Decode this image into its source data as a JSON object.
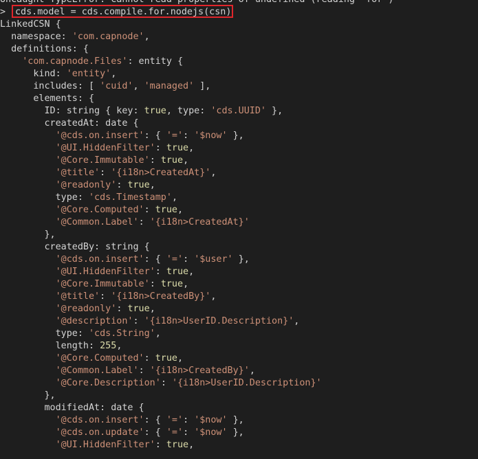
{
  "console": {
    "error_line": "Uncaught TypeError: Cannot read properties of undefined (reading 'for')",
    "prompt_symbol": ">",
    "command": "cds.model = cds.compile.for.nodejs(csn)",
    "highlight_color": "#e0262b",
    "output_lines": [
      [
        {
          "t": "LinkedCSN {",
          "c": "t-cls"
        }
      ],
      [
        {
          "t": "  namespace: ",
          "c": "t-plain"
        },
        {
          "t": "'com.capnode'",
          "c": "t-str"
        },
        {
          "t": ",",
          "c": "t-plain"
        }
      ],
      [
        {
          "t": "  definitions: {",
          "c": "t-plain"
        }
      ],
      [
        {
          "t": "    ",
          "c": "t-plain"
        },
        {
          "t": "'com.capnode.Files'",
          "c": "t-str"
        },
        {
          "t": ": entity {",
          "c": "t-plain"
        }
      ],
      [
        {
          "t": "      kind: ",
          "c": "t-plain"
        },
        {
          "t": "'entity'",
          "c": "t-str"
        },
        {
          "t": ",",
          "c": "t-plain"
        }
      ],
      [
        {
          "t": "      includes: [ ",
          "c": "t-plain"
        },
        {
          "t": "'cuid'",
          "c": "t-str"
        },
        {
          "t": ", ",
          "c": "t-plain"
        },
        {
          "t": "'managed'",
          "c": "t-str"
        },
        {
          "t": " ],",
          "c": "t-plain"
        }
      ],
      [
        {
          "t": "      elements: {",
          "c": "t-plain"
        }
      ],
      [
        {
          "t": "        ID: string { key: ",
          "c": "t-plain"
        },
        {
          "t": "true",
          "c": "t-kw"
        },
        {
          "t": ", type: ",
          "c": "t-plain"
        },
        {
          "t": "'cds.UUID'",
          "c": "t-str"
        },
        {
          "t": " },",
          "c": "t-plain"
        }
      ],
      [
        {
          "t": "        createdAt: date {",
          "c": "t-plain"
        }
      ],
      [
        {
          "t": "          ",
          "c": "t-plain"
        },
        {
          "t": "'@cds.on.insert'",
          "c": "t-str"
        },
        {
          "t": ": { ",
          "c": "t-plain"
        },
        {
          "t": "'='",
          "c": "t-str"
        },
        {
          "t": ": ",
          "c": "t-plain"
        },
        {
          "t": "'$now'",
          "c": "t-str"
        },
        {
          "t": " },",
          "c": "t-plain"
        }
      ],
      [
        {
          "t": "          ",
          "c": "t-plain"
        },
        {
          "t": "'@UI.HiddenFilter'",
          "c": "t-str"
        },
        {
          "t": ": ",
          "c": "t-plain"
        },
        {
          "t": "true",
          "c": "t-kw"
        },
        {
          "t": ",",
          "c": "t-plain"
        }
      ],
      [
        {
          "t": "          ",
          "c": "t-plain"
        },
        {
          "t": "'@Core.Immutable'",
          "c": "t-str"
        },
        {
          "t": ": ",
          "c": "t-plain"
        },
        {
          "t": "true",
          "c": "t-kw"
        },
        {
          "t": ",",
          "c": "t-plain"
        }
      ],
      [
        {
          "t": "          ",
          "c": "t-plain"
        },
        {
          "t": "'@title'",
          "c": "t-str"
        },
        {
          "t": ": ",
          "c": "t-plain"
        },
        {
          "t": "'{i18n>CreatedAt}'",
          "c": "t-str"
        },
        {
          "t": ",",
          "c": "t-plain"
        }
      ],
      [
        {
          "t": "          ",
          "c": "t-plain"
        },
        {
          "t": "'@readonly'",
          "c": "t-str"
        },
        {
          "t": ": ",
          "c": "t-plain"
        },
        {
          "t": "true",
          "c": "t-kw"
        },
        {
          "t": ",",
          "c": "t-plain"
        }
      ],
      [
        {
          "t": "          type: ",
          "c": "t-plain"
        },
        {
          "t": "'cds.Timestamp'",
          "c": "t-str"
        },
        {
          "t": ",",
          "c": "t-plain"
        }
      ],
      [
        {
          "t": "          ",
          "c": "t-plain"
        },
        {
          "t": "'@Core.Computed'",
          "c": "t-str"
        },
        {
          "t": ": ",
          "c": "t-plain"
        },
        {
          "t": "true",
          "c": "t-kw"
        },
        {
          "t": ",",
          "c": "t-plain"
        }
      ],
      [
        {
          "t": "          ",
          "c": "t-plain"
        },
        {
          "t": "'@Common.Label'",
          "c": "t-str"
        },
        {
          "t": ": ",
          "c": "t-plain"
        },
        {
          "t": "'{i18n>CreatedAt}'",
          "c": "t-str"
        }
      ],
      [
        {
          "t": "        },",
          "c": "t-plain"
        }
      ],
      [
        {
          "t": "        createdBy: string {",
          "c": "t-plain"
        }
      ],
      [
        {
          "t": "          ",
          "c": "t-plain"
        },
        {
          "t": "'@cds.on.insert'",
          "c": "t-str"
        },
        {
          "t": ": { ",
          "c": "t-plain"
        },
        {
          "t": "'='",
          "c": "t-str"
        },
        {
          "t": ": ",
          "c": "t-plain"
        },
        {
          "t": "'$user'",
          "c": "t-str"
        },
        {
          "t": " },",
          "c": "t-plain"
        }
      ],
      [
        {
          "t": "          ",
          "c": "t-plain"
        },
        {
          "t": "'@UI.HiddenFilter'",
          "c": "t-str"
        },
        {
          "t": ": ",
          "c": "t-plain"
        },
        {
          "t": "true",
          "c": "t-kw"
        },
        {
          "t": ",",
          "c": "t-plain"
        }
      ],
      [
        {
          "t": "          ",
          "c": "t-plain"
        },
        {
          "t": "'@Core.Immutable'",
          "c": "t-str"
        },
        {
          "t": ": ",
          "c": "t-plain"
        },
        {
          "t": "true",
          "c": "t-kw"
        },
        {
          "t": ",",
          "c": "t-plain"
        }
      ],
      [
        {
          "t": "          ",
          "c": "t-plain"
        },
        {
          "t": "'@title'",
          "c": "t-str"
        },
        {
          "t": ": ",
          "c": "t-plain"
        },
        {
          "t": "'{i18n>CreatedBy}'",
          "c": "t-str"
        },
        {
          "t": ",",
          "c": "t-plain"
        }
      ],
      [
        {
          "t": "          ",
          "c": "t-plain"
        },
        {
          "t": "'@readonly'",
          "c": "t-str"
        },
        {
          "t": ": ",
          "c": "t-plain"
        },
        {
          "t": "true",
          "c": "t-kw"
        },
        {
          "t": ",",
          "c": "t-plain"
        }
      ],
      [
        {
          "t": "          ",
          "c": "t-plain"
        },
        {
          "t": "'@description'",
          "c": "t-str"
        },
        {
          "t": ": ",
          "c": "t-plain"
        },
        {
          "t": "'{i18n>UserID.Description}'",
          "c": "t-str"
        },
        {
          "t": ",",
          "c": "t-plain"
        }
      ],
      [
        {
          "t": "          type: ",
          "c": "t-plain"
        },
        {
          "t": "'cds.String'",
          "c": "t-str"
        },
        {
          "t": ",",
          "c": "t-plain"
        }
      ],
      [
        {
          "t": "          length: ",
          "c": "t-plain"
        },
        {
          "t": "255",
          "c": "t-kw"
        },
        {
          "t": ",",
          "c": "t-plain"
        }
      ],
      [
        {
          "t": "          ",
          "c": "t-plain"
        },
        {
          "t": "'@Core.Computed'",
          "c": "t-str"
        },
        {
          "t": ": ",
          "c": "t-plain"
        },
        {
          "t": "true",
          "c": "t-kw"
        },
        {
          "t": ",",
          "c": "t-plain"
        }
      ],
      [
        {
          "t": "          ",
          "c": "t-plain"
        },
        {
          "t": "'@Common.Label'",
          "c": "t-str"
        },
        {
          "t": ": ",
          "c": "t-plain"
        },
        {
          "t": "'{i18n>CreatedBy}'",
          "c": "t-str"
        },
        {
          "t": ",",
          "c": "t-plain"
        }
      ],
      [
        {
          "t": "          ",
          "c": "t-plain"
        },
        {
          "t": "'@Core.Description'",
          "c": "t-str"
        },
        {
          "t": ": ",
          "c": "t-plain"
        },
        {
          "t": "'{i18n>UserID.Description}'",
          "c": "t-str"
        }
      ],
      [
        {
          "t": "        },",
          "c": "t-plain"
        }
      ],
      [
        {
          "t": "        modifiedAt: date {",
          "c": "t-plain"
        }
      ],
      [
        {
          "t": "          ",
          "c": "t-plain"
        },
        {
          "t": "'@cds.on.insert'",
          "c": "t-str"
        },
        {
          "t": ": { ",
          "c": "t-plain"
        },
        {
          "t": "'='",
          "c": "t-str"
        },
        {
          "t": ": ",
          "c": "t-plain"
        },
        {
          "t": "'$now'",
          "c": "t-str"
        },
        {
          "t": " },",
          "c": "t-plain"
        }
      ],
      [
        {
          "t": "          ",
          "c": "t-plain"
        },
        {
          "t": "'@cds.on.update'",
          "c": "t-str"
        },
        {
          "t": ": { ",
          "c": "t-plain"
        },
        {
          "t": "'='",
          "c": "t-str"
        },
        {
          "t": ": ",
          "c": "t-plain"
        },
        {
          "t": "'$now'",
          "c": "t-str"
        },
        {
          "t": " },",
          "c": "t-plain"
        }
      ],
      [
        {
          "t": "          ",
          "c": "t-plain"
        },
        {
          "t": "'@UI.HiddenFilter'",
          "c": "t-str"
        },
        {
          "t": ": ",
          "c": "t-plain"
        },
        {
          "t": "true",
          "c": "t-kw"
        },
        {
          "t": ",",
          "c": "t-plain"
        }
      ]
    ]
  }
}
